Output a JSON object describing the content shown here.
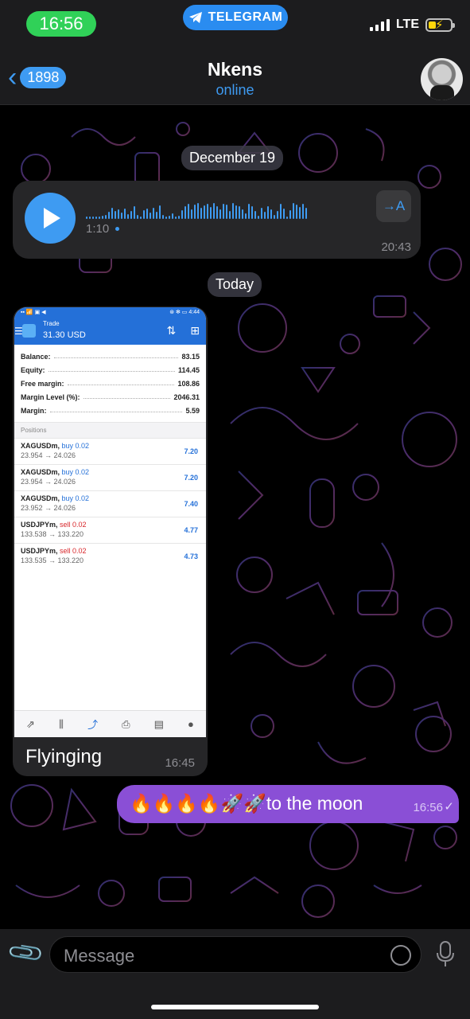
{
  "status_bar": {
    "time": "16:56",
    "app_pill": "TELEGRAM",
    "network": "LTE"
  },
  "header": {
    "back_count": "1898",
    "title": "Nkens",
    "subtitle": "online"
  },
  "messages": {
    "date_chip_1": "December 19",
    "voice": {
      "duration": "1:10",
      "time": "20:43",
      "transcribe_label": "→A"
    },
    "date_chip_2": "Today",
    "photo": {
      "caption": "Flyinging",
      "time": "16:45",
      "screenshot": {
        "status_left": "▪▪ 📶 ▣ ◀",
        "status_right": "⊛ ✻ ▭ 4:44",
        "app_title": "Trade",
        "balance_header": "31.30 USD",
        "summary": [
          {
            "label": "Balance:",
            "value": "83.15"
          },
          {
            "label": "Equity:",
            "value": "114.45"
          },
          {
            "label": "Free margin:",
            "value": "108.86"
          },
          {
            "label": "Margin Level (%):",
            "value": "2046.31"
          },
          {
            "label": "Margin:",
            "value": "5.59"
          }
        ],
        "positions_title": "Positions",
        "positions": [
          {
            "symbol": "XAGUSDm,",
            "side": " buy 0.02",
            "prices": "23.954 → 24.026",
            "pl": "7.20",
            "type": "buy"
          },
          {
            "symbol": "XAGUSDm,",
            "side": " buy 0.02",
            "prices": "23.954 → 24.026",
            "pl": "7.20",
            "type": "buy"
          },
          {
            "symbol": "XAGUSDm,",
            "side": " buy 0.02",
            "prices": "23.952 → 24.026",
            "pl": "7.40",
            "type": "buy"
          },
          {
            "symbol": "USDJPYm,",
            "side": " sell 0.02",
            "prices": "133.538 → 133.220",
            "pl": "4.77",
            "type": "sell"
          },
          {
            "symbol": "USDJPYm,",
            "side": " sell 0.02",
            "prices": "133.535 → 133.220",
            "pl": "4.73",
            "type": "sell"
          }
        ]
      }
    },
    "outgoing": {
      "text": "🔥🔥🔥🔥🚀🚀to the moon",
      "time": "16:56",
      "check": "✓"
    }
  },
  "input": {
    "placeholder": "Message"
  },
  "colors": {
    "accent": "#3e9bf2",
    "outgoing_bubble": "#8a4fd6",
    "time_pill": "#30d158"
  }
}
